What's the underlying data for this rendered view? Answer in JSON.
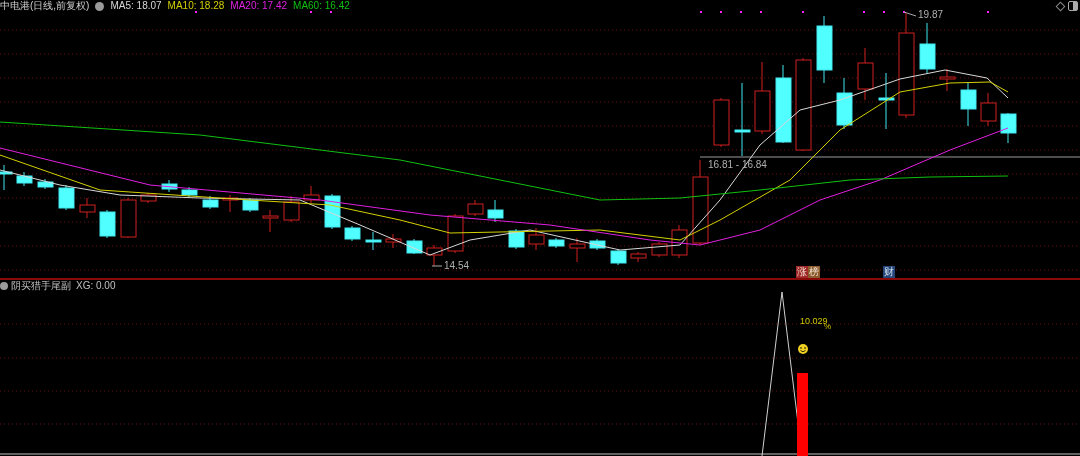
{
  "title": "中电港(日线,前复权)",
  "indicators": [
    {
      "label": "MA5: 18.07",
      "color": "#d8d8d8"
    },
    {
      "label": "MA10: 18.28",
      "color": "#d4d000"
    },
    {
      "label": "MA20: 17.42",
      "color": "#e020e0"
    },
    {
      "label": "MA60: 16.42",
      "color": "#10c010"
    }
  ],
  "price_labels": [
    {
      "kind": "high",
      "text": "19.87"
    },
    {
      "kind": "range",
      "text": "16.81 - 16.84"
    },
    {
      "kind": "low",
      "text": "14.54"
    }
  ],
  "event_badges": [
    {
      "text": "涨",
      "color": "#a02828"
    },
    {
      "text": "榜",
      "color": "#8a5a2a"
    },
    {
      "text": "财",
      "color": "#24467a"
    }
  ],
  "sub_panel": {
    "title": "阴买猎手尾副",
    "reading": "XG: 0.00",
    "signal_label": "10.029",
    "unit": "%"
  }
}
